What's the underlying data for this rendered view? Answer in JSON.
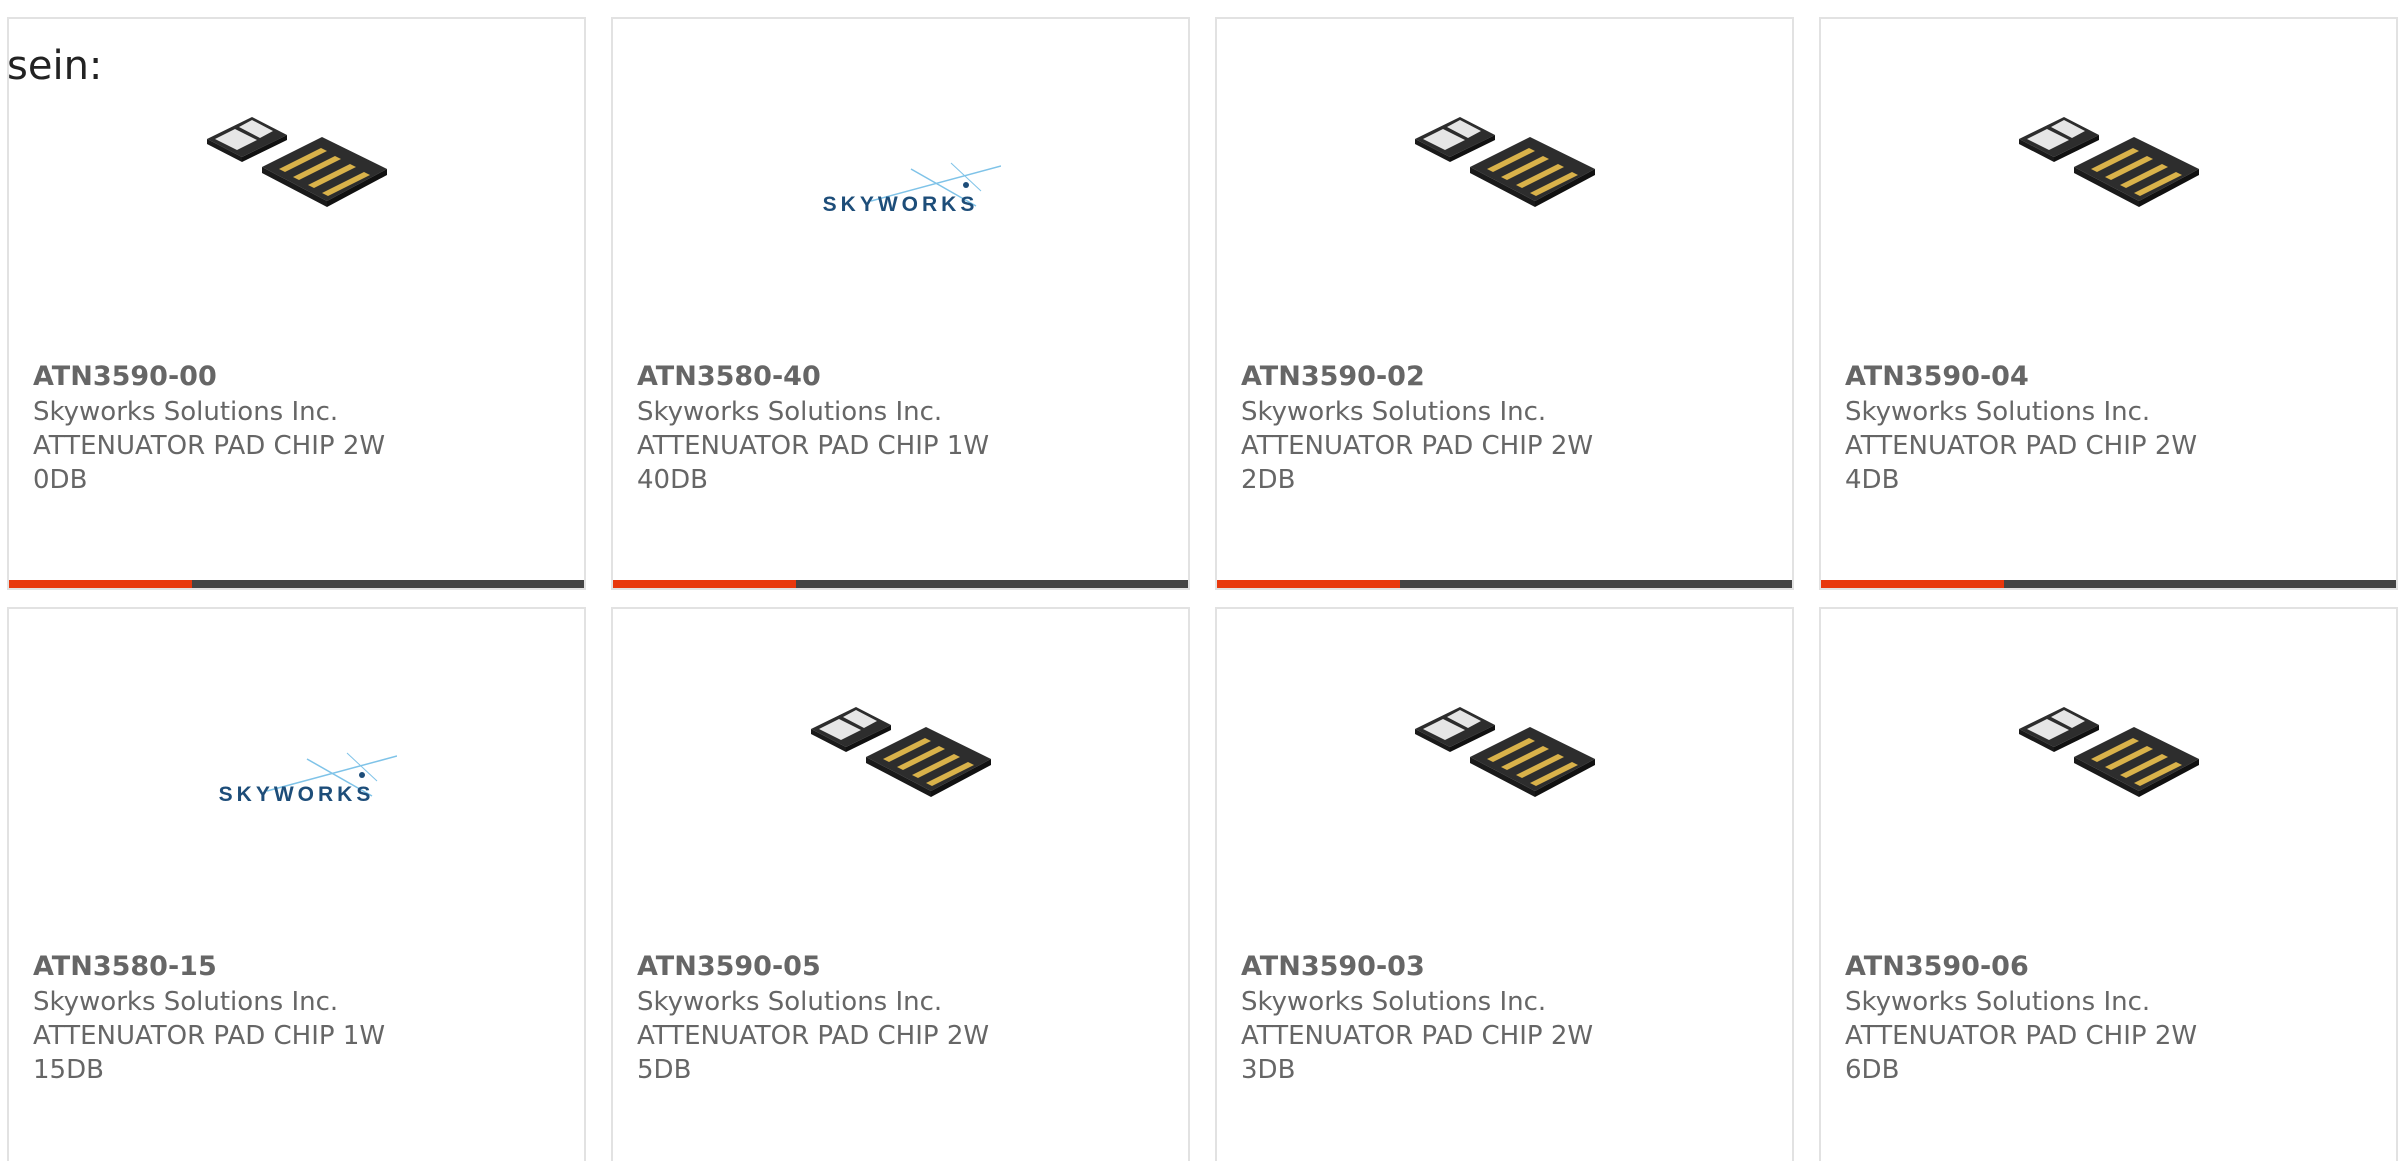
{
  "intro_text": "sein:",
  "accent_color": "#e8380d",
  "cards": [
    {
      "part_number": "ATN3590-00",
      "manufacturer": "Skyworks Solutions Inc.",
      "description": "ATTENUATOR PAD CHIP 2W 0DB",
      "image": "chip-image"
    },
    {
      "part_number": "ATN3580-40",
      "manufacturer": "Skyworks Solutions Inc.",
      "description": "ATTENUATOR PAD CHIP 1W 40DB",
      "image": "skyworks-logo",
      "logo_text": "SKYWORKS"
    },
    {
      "part_number": "ATN3590-02",
      "manufacturer": "Skyworks Solutions Inc.",
      "description": "ATTENUATOR PAD CHIP 2W 2DB",
      "image": "chip-image"
    },
    {
      "part_number": "ATN3590-04",
      "manufacturer": "Skyworks Solutions Inc.",
      "description": "ATTENUATOR PAD CHIP 2W 4DB",
      "image": "chip-image"
    },
    {
      "part_number": "ATN3580-15",
      "manufacturer": "Skyworks Solutions Inc.",
      "description": "ATTENUATOR PAD CHIP 1W 15DB",
      "image": "skyworks-logo",
      "logo_text": "SKYWORKS"
    },
    {
      "part_number": "ATN3590-05",
      "manufacturer": "Skyworks Solutions Inc.",
      "description": "ATTENUATOR PAD CHIP 2W 5DB",
      "image": "chip-image"
    },
    {
      "part_number": "ATN3590-03",
      "manufacturer": "Skyworks Solutions Inc.",
      "description": "ATTENUATOR PAD CHIP 2W 3DB",
      "image": "chip-image"
    },
    {
      "part_number": "ATN3590-06",
      "manufacturer": "Skyworks Solutions Inc.",
      "description": "ATTENUATOR PAD CHIP 2W 6DB",
      "image": "chip-image"
    }
  ]
}
